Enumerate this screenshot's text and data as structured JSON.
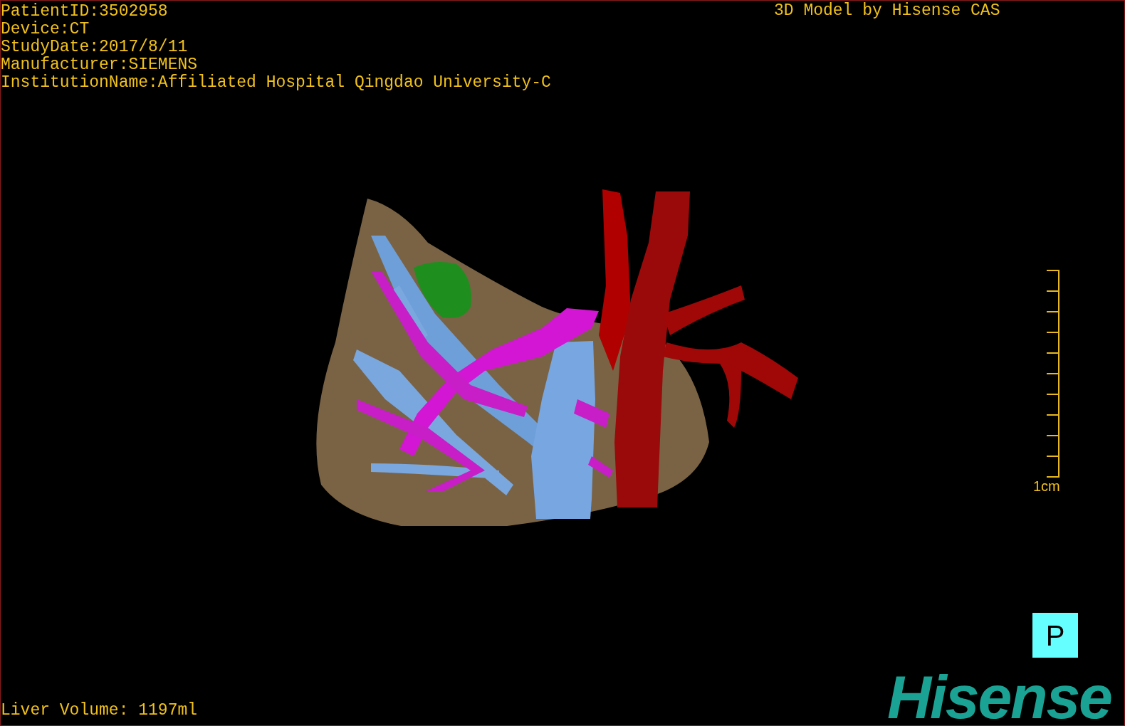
{
  "patient_info": [
    "PatientID:3502958",
    "Device:CT",
    "StudyDate:2017/8/11",
    "Manufacturer:SIEMENS",
    "InstitutionName:Affiliated Hospital Qingdao University-C"
  ],
  "model_credit": "3D Model by Hisense CAS",
  "scale_bar": {
    "label": "1cm"
  },
  "orientation_marker": "P",
  "liver_volume": "Liver Volume: 1197ml",
  "logo": "Hisense"
}
